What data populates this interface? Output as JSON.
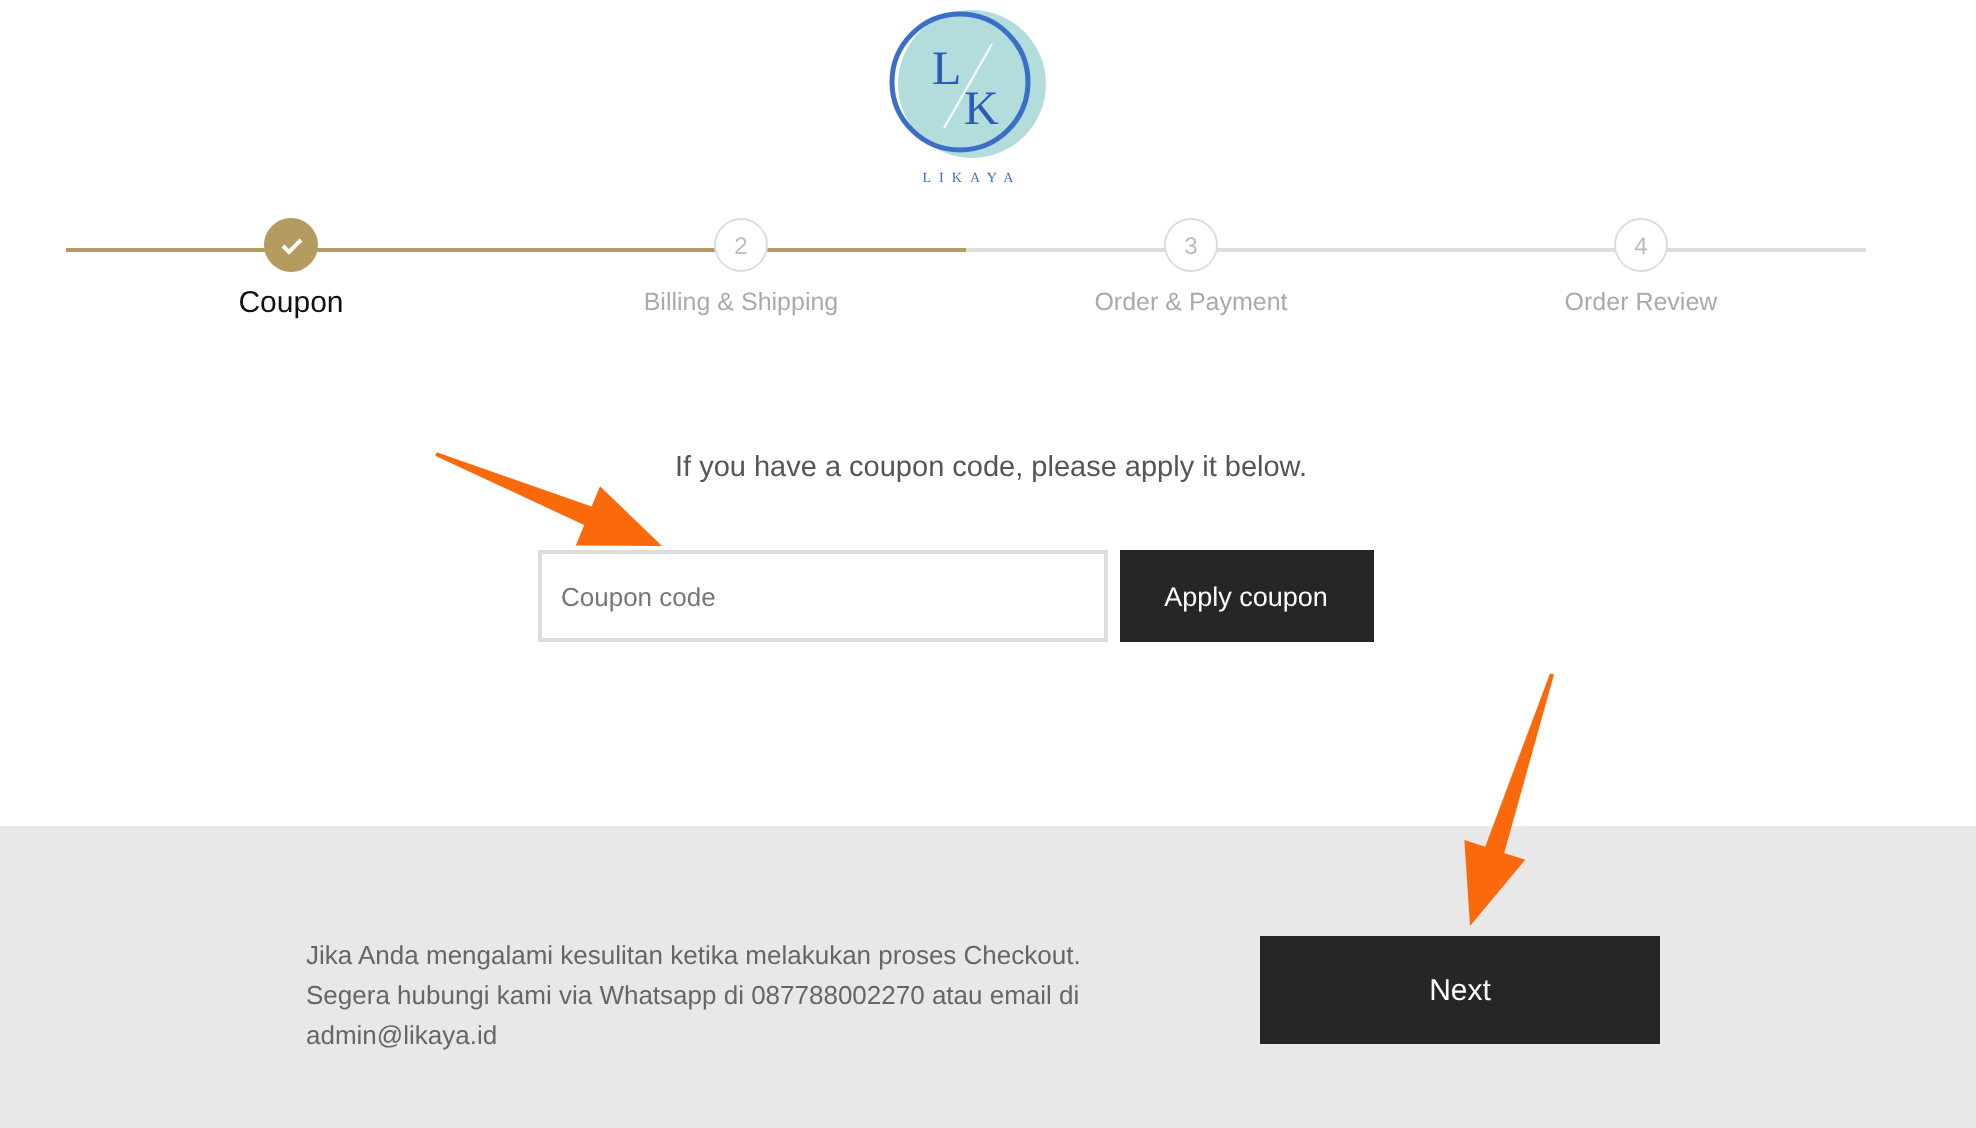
{
  "logo": {
    "initials": [
      "L",
      "K"
    ],
    "name": "LIKAYA"
  },
  "stepper": {
    "progress": {
      "level": 0.5
    },
    "steps": [
      {
        "label": "Coupon",
        "completed": true,
        "selected": true
      },
      {
        "label": "Billing & Shipping",
        "number": "2",
        "completed": false,
        "selected": false
      },
      {
        "label": "Order & Payment",
        "number": "3",
        "completed": false,
        "selected": false
      },
      {
        "label": "Order Review",
        "number": "4",
        "completed": false,
        "selected": false
      }
    ]
  },
  "coupon": {
    "prompt": "If you have a coupon code, please apply it below.",
    "field": {
      "placeholder": "Coupon code"
    },
    "button": "Apply coupon"
  },
  "footer": {
    "help_text": "Jika Anda mengalami kesulitan ketika melakukan proses Checkout. Segera hubungi kami via Whatsapp di 087788002270 atau email di admin@likaya.id",
    "next_button": "Next"
  }
}
